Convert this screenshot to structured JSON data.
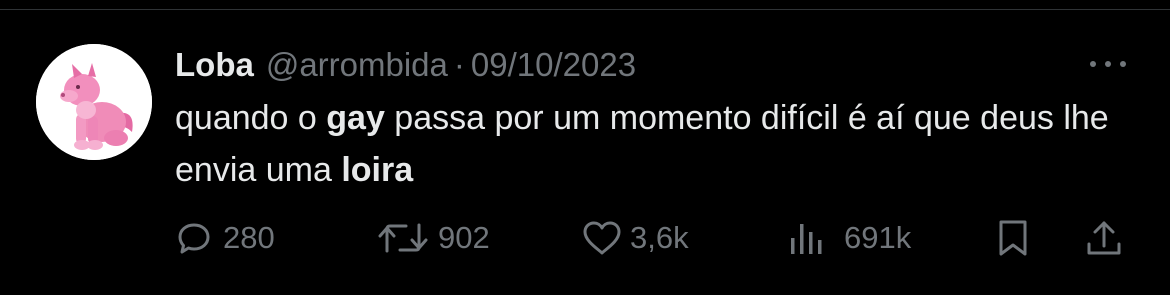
{
  "tweet": {
    "author_name": "Loba",
    "author_handle": "@arrombida",
    "separator": "·",
    "date": "09/10/2023",
    "text": {
      "part1": "quando o ",
      "bold1": "gay",
      "part2": " passa por um momento difícil é aí que deus lhe envia uma ",
      "bold2": "loira"
    }
  },
  "actions": {
    "replies": "280",
    "retweets": "902",
    "likes": "3,6k",
    "views": "691k"
  },
  "icons": {
    "reply": "reply-icon",
    "retweet": "retweet-icon",
    "like": "heart-icon",
    "views": "views-icon",
    "bookmark": "bookmark-icon",
    "share": "share-icon",
    "more": "more-icon"
  },
  "colors": {
    "background": "#000000",
    "text": "#e7e9ea",
    "muted": "#71767b",
    "divider": "#2f3336",
    "avatar_plush": "#f08cb8"
  }
}
